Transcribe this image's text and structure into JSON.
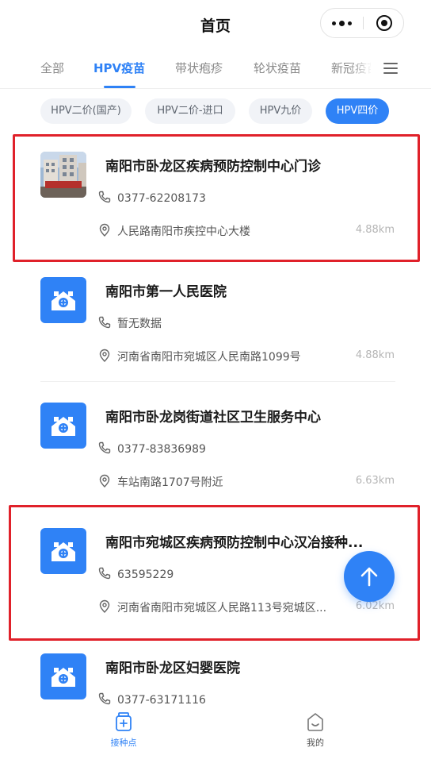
{
  "header": {
    "title": "首页"
  },
  "tabs": [
    {
      "label": "全部",
      "active": false
    },
    {
      "label": "HPV疫苗",
      "active": true
    },
    {
      "label": "带状疱疹",
      "active": false
    },
    {
      "label": "轮状疫苗",
      "active": false
    },
    {
      "label": "新冠疫苗",
      "active": false
    }
  ],
  "chips": [
    {
      "label": "HPV二价(国产)",
      "active": false
    },
    {
      "label": "HPV二价-进口",
      "active": false
    },
    {
      "label": "HPV九价",
      "active": false
    },
    {
      "label": "HPV四价",
      "active": true
    }
  ],
  "sites": [
    {
      "name": "南阳市卧龙区疾病预防控制中心门诊",
      "phone": "0377-62208173",
      "address": "人民路南阳市疾控中心大楼",
      "distance": "4.88km",
      "thumb": "photo",
      "highlighted": true
    },
    {
      "name": "南阳市第一人民医院",
      "phone": "暂无数据",
      "address": "河南省南阳市宛城区人民南路1099号",
      "distance": "4.88km",
      "thumb": "hospital-icon",
      "highlighted": false
    },
    {
      "name": "南阳市卧龙岗街道社区卫生服务中心",
      "phone": "0377-83836989",
      "address": "车站南路1707号附近",
      "distance": "6.63km",
      "thumb": "hospital-icon",
      "highlighted": false
    },
    {
      "name": "南阳市宛城区疾病预防控制中心汉冶接种...",
      "phone": "63595229",
      "address": "河南省南阳市宛城区人民路113号宛城区...",
      "distance": "6.02km",
      "thumb": "hospital-icon",
      "highlighted": true
    },
    {
      "name": "南阳市卧龙区妇婴医院",
      "phone": "0377-63171116",
      "address": "",
      "distance": "",
      "thumb": "hospital-icon",
      "highlighted": false
    }
  ],
  "bottom_nav": [
    {
      "label": "接种点",
      "icon": "vaccine-bottle-icon",
      "active": true
    },
    {
      "label": "我的",
      "icon": "profile-icon",
      "active": false
    }
  ],
  "colors": {
    "accent": "#2f82f6",
    "highlight": "#e0212a"
  }
}
